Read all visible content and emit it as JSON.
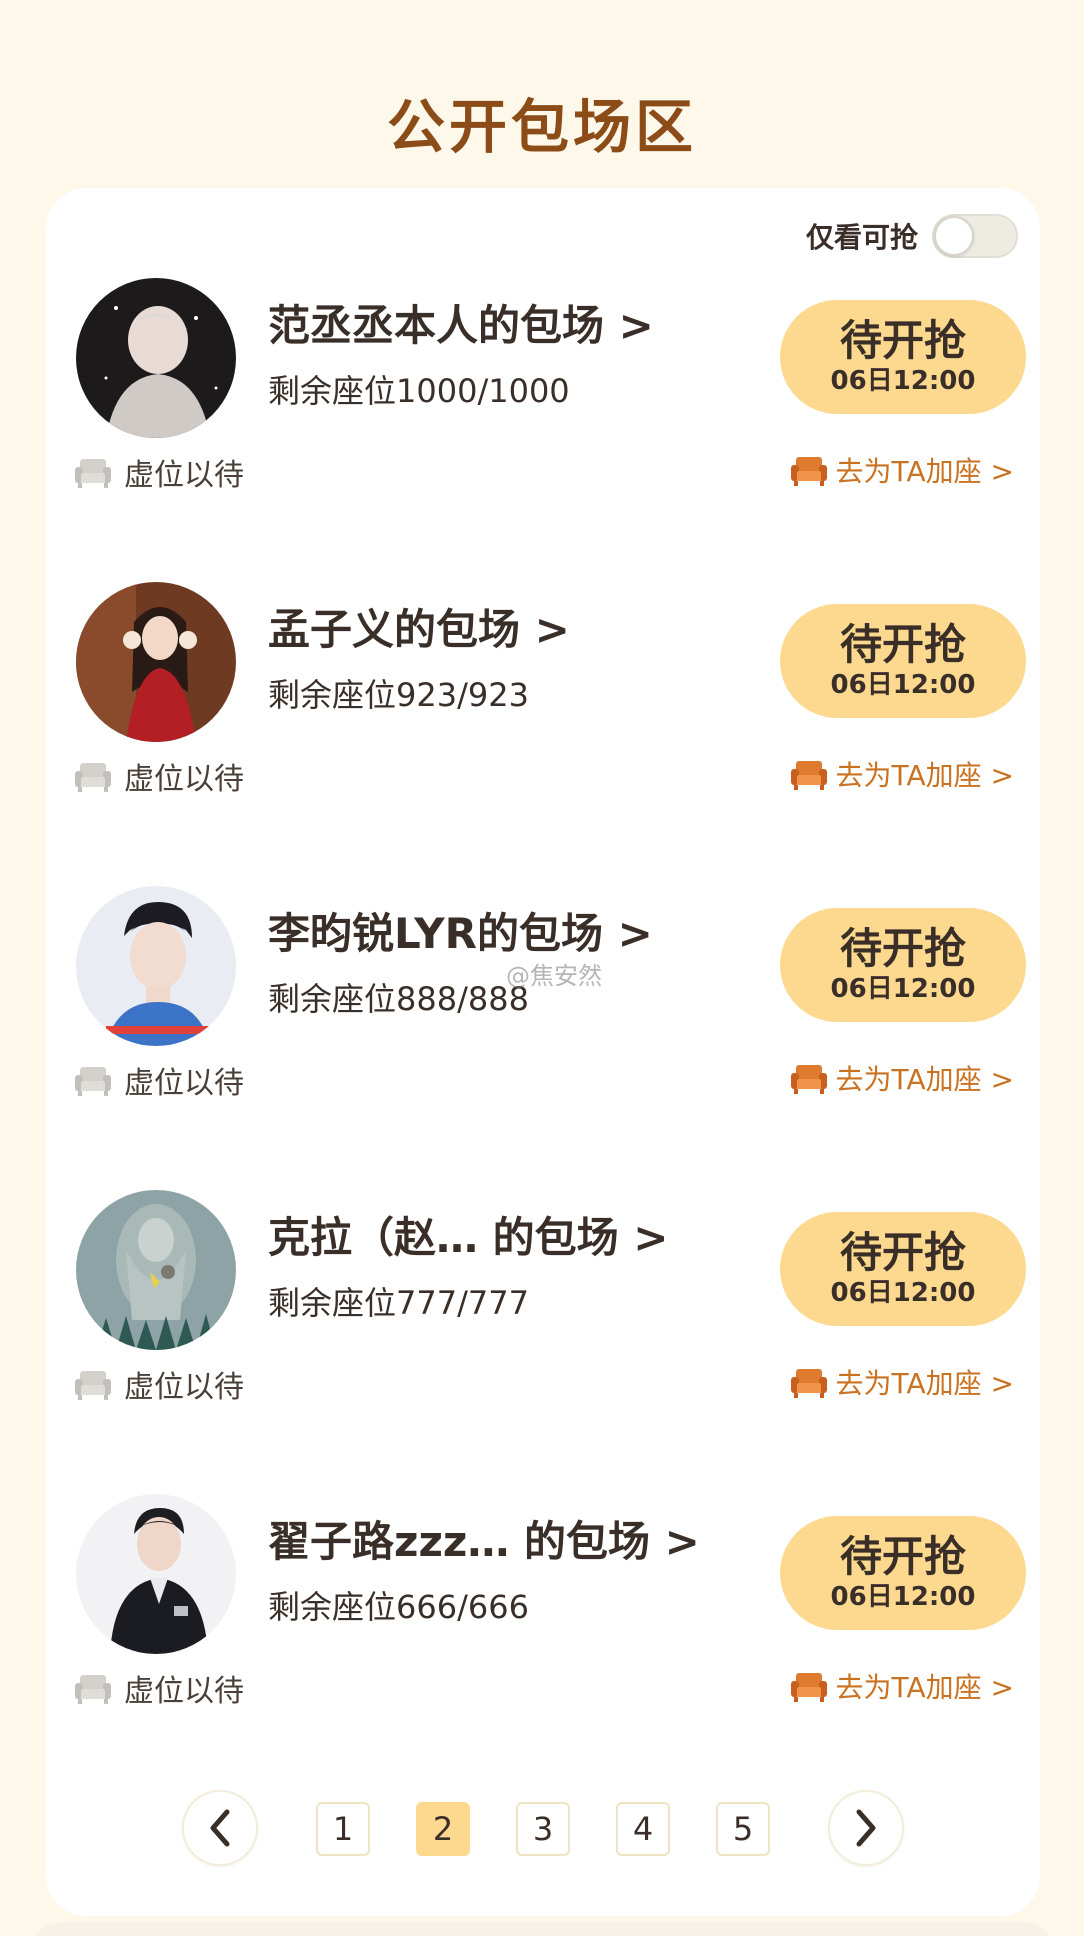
{
  "section_title": "公开包场区",
  "filter": {
    "label": "仅看可抢",
    "enabled": false
  },
  "items": [
    {
      "name": "范丞丞本人的包场 >",
      "seats": "剩余座位1000/1000",
      "button_main": "待开抢",
      "button_time": "06日12:00",
      "virtual": "虚位以待",
      "add_seat": "去为TA加座 >"
    },
    {
      "name": "孟子义的包场 >",
      "seats": "剩余座位923/923",
      "button_main": "待开抢",
      "button_time": "06日12:00",
      "virtual": "虚位以待",
      "add_seat": "去为TA加座 >"
    },
    {
      "name": "李昀锐LYR的包场 >",
      "seats": "剩余座位888/888",
      "button_main": "待开抢",
      "button_time": "06日12:00",
      "virtual": "虚位以待",
      "add_seat": "去为TA加座 >"
    },
    {
      "name": "克拉（赵… 的包场 >",
      "seats": "剩余座位777/777",
      "button_main": "待开抢",
      "button_time": "06日12:00",
      "virtual": "虚位以待",
      "add_seat": "去为TA加座 >"
    },
    {
      "name": "翟子路zzz… 的包场 >",
      "seats": "剩余座位666/666",
      "button_main": "待开抢",
      "button_time": "06日12:00",
      "virtual": "虚位以待",
      "add_seat": "去为TA加座 >"
    }
  ],
  "pagination": {
    "pages": [
      "1",
      "2",
      "3",
      "4",
      "5"
    ],
    "current": "2"
  },
  "watermark": "@焦安然",
  "colors": {
    "title": "#8b4c18",
    "button": "#fcd98f",
    "add_seat": "#c97321",
    "background": "#fdf8e9"
  }
}
